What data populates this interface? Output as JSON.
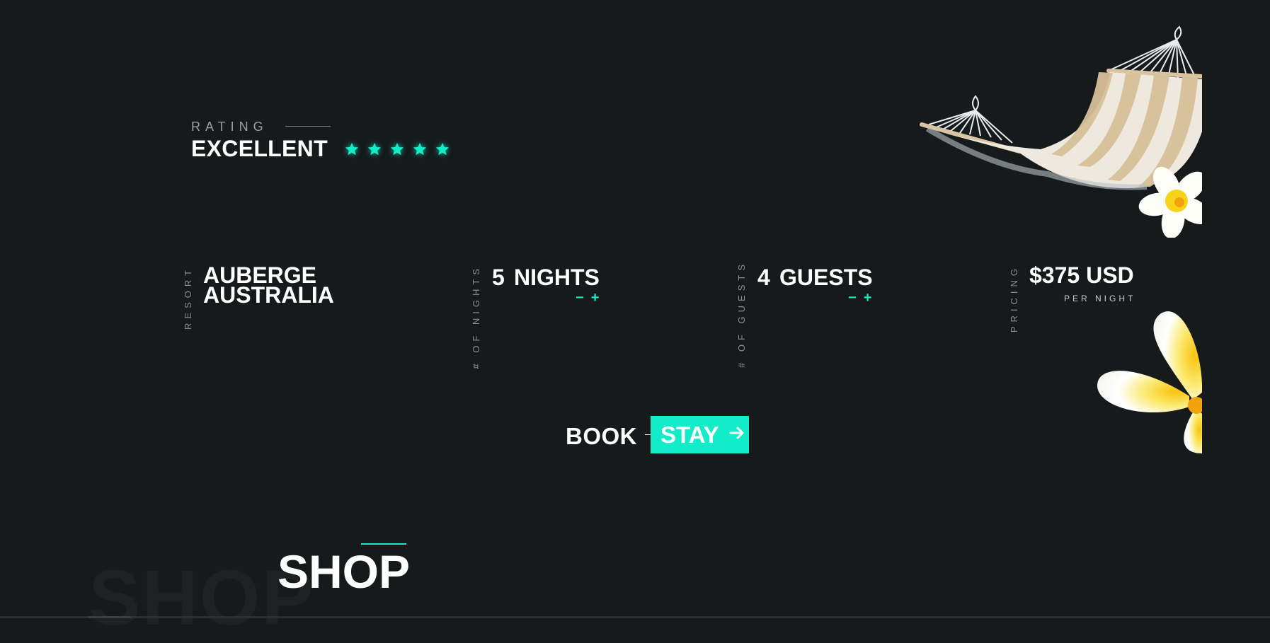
{
  "rating": {
    "label": "RATING",
    "value": "EXCELLENT",
    "stars": 5,
    "star_color": "#12ecc8"
  },
  "booking": {
    "resort": {
      "label": "RESORT",
      "line1": "AUBERGE",
      "line2": "AUSTRALIA"
    },
    "nights": {
      "label": "# OF NIGHTS",
      "count": "5",
      "unit": "NIGHTS",
      "minus": "−",
      "plus": "+"
    },
    "guests": {
      "label": "# OF GUESTS",
      "count": "4",
      "unit": "GUESTS",
      "minus": "−",
      "plus": "+"
    },
    "pricing": {
      "label": "PRICING",
      "value": "$375 USD",
      "sub": "PER NIGHT"
    }
  },
  "cta": {
    "book": "BOOK",
    "stay": "STAY",
    "arrow_icon": "arrow-right-icon"
  },
  "shop": {
    "title": "SHOP",
    "ghost": "SHOP"
  },
  "colors": {
    "background": "#161a1b",
    "accent": "#12ecc8",
    "text": "#ffffff",
    "muted": "#8a9092"
  }
}
